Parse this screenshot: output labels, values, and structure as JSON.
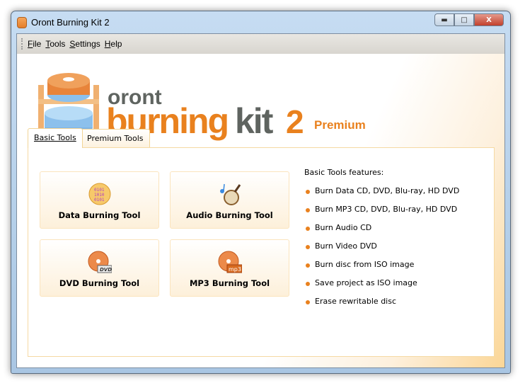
{
  "window": {
    "title": "Oront Burning Kit 2",
    "controls": [
      "minimize",
      "maximize",
      "close"
    ]
  },
  "menu": [
    {
      "label": "File",
      "key": "F",
      "rest": "ile"
    },
    {
      "label": "Tools",
      "key": "T",
      "rest": "ools"
    },
    {
      "label": "Settings",
      "key": "S",
      "rest": "ettings"
    },
    {
      "label": "Help",
      "key": "H",
      "rest": "elp"
    }
  ],
  "logo": {
    "line1": "oront",
    "word_a": "burning",
    "word_b": "kit",
    "number": "2",
    "edition": "Premium"
  },
  "tabs": [
    {
      "label": "Basic Tools",
      "active": true
    },
    {
      "label": "Premium Tools",
      "active": false
    }
  ],
  "tools": [
    {
      "label": "Data Burning Tool",
      "icon": "data-disc-icon"
    },
    {
      "label": "Audio Burning Tool",
      "icon": "lute-music-icon"
    },
    {
      "label": "DVD Burning Tool",
      "icon": "dvd-disc-icon"
    },
    {
      "label": "MP3 Burning Tool",
      "icon": "mp3-disc-icon"
    }
  ],
  "features": {
    "title": "Basic Tools features:",
    "items": [
      "Burn Data CD, DVD, Blu-ray, HD DVD",
      "Burn MP3 CD, DVD, Blu-ray, HD DVD",
      "Burn Audio CD",
      "Burn Video DVD",
      "Burn disc from ISO image",
      "Save project as ISO image",
      "Erase rewritable disc"
    ]
  },
  "colors": {
    "accent": "#e9811e",
    "logo_gray": "#5f6460"
  }
}
